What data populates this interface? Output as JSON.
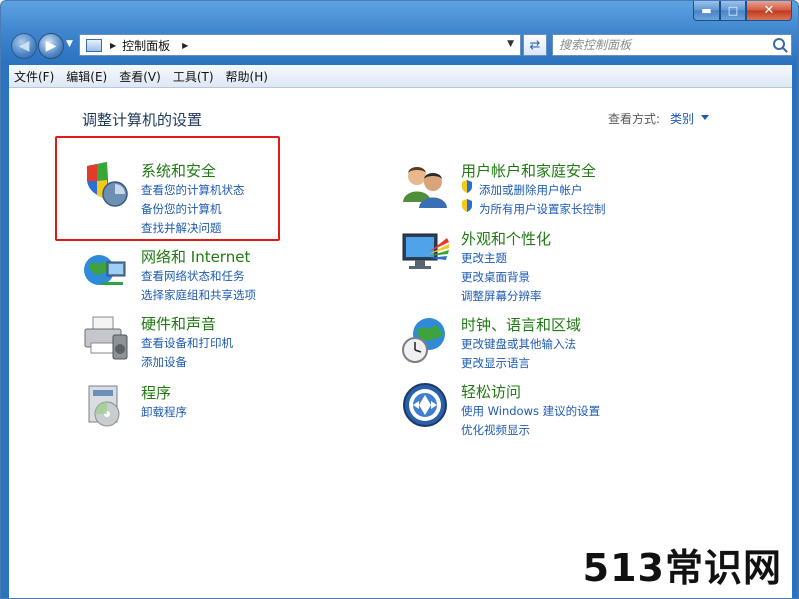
{
  "titlebar": {
    "min_label": "▬",
    "max_label": "□",
    "close_label": "✕"
  },
  "nav": {
    "breadcrumb": "控制面板",
    "search_placeholder": "搜索控制面板"
  },
  "menubar": [
    "文件(F)",
    "编辑(E)",
    "查看(V)",
    "工具(T)",
    "帮助(H)"
  ],
  "content": {
    "heading": "调整计算机的设置",
    "view_by_label": "查看方式:",
    "view_by_value": "类别"
  },
  "categories": [
    {
      "title": "系统和安全",
      "icon": "shield-icon",
      "links": [
        "查看您的计算机状态",
        "备份您的计算机",
        "查找并解决问题"
      ]
    },
    {
      "title": "网络和 Internet",
      "icon": "network-globe-icon",
      "links": [
        "查看网络状态和任务",
        "选择家庭组和共享选项"
      ]
    },
    {
      "title": "硬件和声音",
      "icon": "printer-icon",
      "links": [
        "查看设备和打印机",
        "添加设备"
      ]
    },
    {
      "title": "程序",
      "icon": "programs-icon",
      "links": [
        "卸载程序"
      ]
    },
    {
      "title": "用户帐户和家庭安全",
      "icon": "users-icon",
      "links": [
        "添加或删除用户帐户",
        "为所有用户设置家长控制"
      ]
    },
    {
      "title": "外观和个性化",
      "icon": "monitor-palette-icon",
      "links": [
        "更改主题",
        "更改桌面背景",
        "调整屏幕分辨率"
      ]
    },
    {
      "title": "时钟、语言和区域",
      "icon": "clock-globe-icon",
      "links": [
        "更改键盘或其他输入法",
        "更改显示语言"
      ]
    },
    {
      "title": "轻松访问",
      "icon": "ease-of-access-icon",
      "links": [
        "使用 Windows 建议的设置",
        "优化视频显示"
      ]
    }
  ],
  "watermark": "513常识网",
  "colors": {
    "title_green": "#1f7a12",
    "link_blue": "#1e5bb3",
    "highlight_red": "#e01919",
    "chrome_blue": "#2c73bf"
  }
}
